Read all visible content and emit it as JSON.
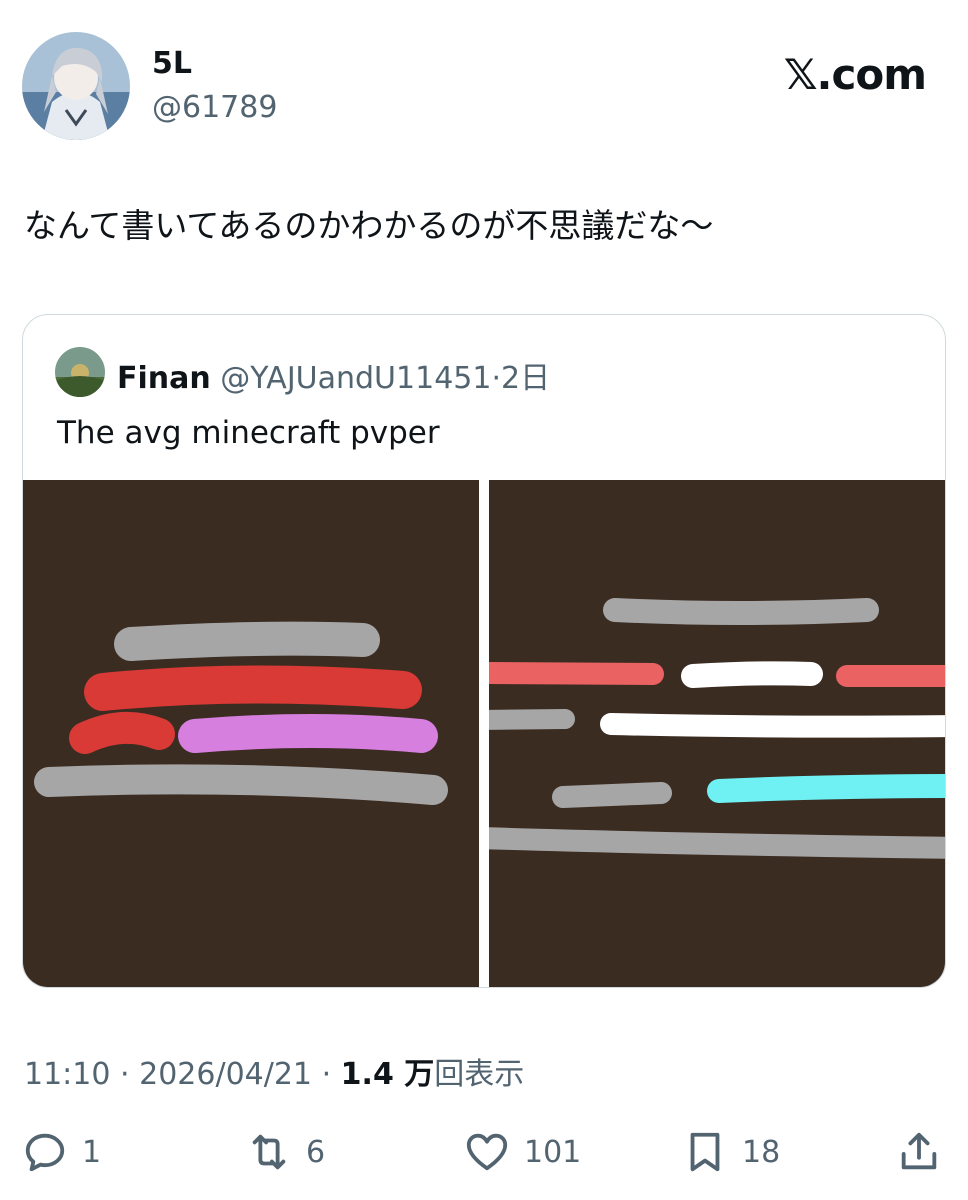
{
  "author": {
    "display_name": "5L",
    "handle": "@61789",
    "avatar_icon": "anime-avatar-image"
  },
  "brand": "𝕏.com",
  "tweet": {
    "text": "なんて書いてあるのかわかるのが不思議だな〜"
  },
  "quote": {
    "display_name": "Finan",
    "handle": "@YAJUandU11451",
    "separator": "·",
    "age": "2日",
    "text": "The avg minecraft pvper",
    "media": [
      {
        "description_icon": "scribble-lines-image-left",
        "background": "#3b2c22"
      },
      {
        "description_icon": "scribble-lines-image-right",
        "background": "#3b2c22"
      }
    ]
  },
  "meta": {
    "time": "11:10",
    "sep1": "·",
    "date": "2026/04/21",
    "sep2": "·",
    "views": "1.4 万",
    "views_label": "回表示"
  },
  "actions": {
    "reply_count": "1",
    "retweet_count": "6",
    "like_count": "101",
    "bookmark_count": "18"
  },
  "colors": {
    "text": "#0f1419",
    "muted": "#536471",
    "border": "#cfd9de",
    "image_bg": "#3b2c22"
  }
}
